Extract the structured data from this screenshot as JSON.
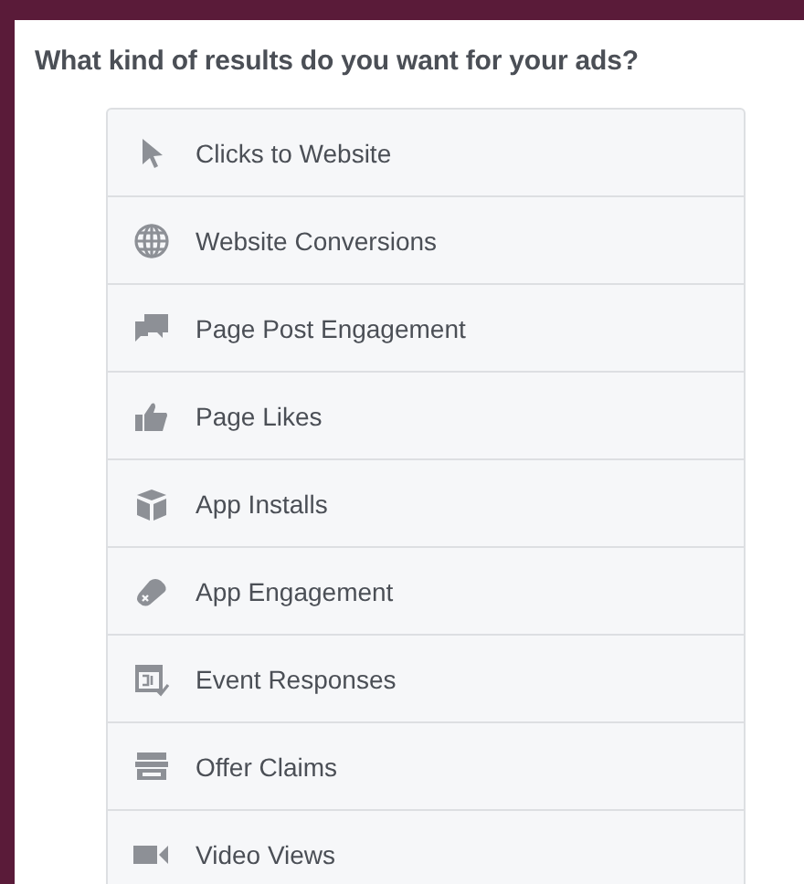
{
  "heading": "What kind of results do you want for your ads?",
  "options": [
    {
      "label": "Clicks to Website"
    },
    {
      "label": "Website Conversions"
    },
    {
      "label": "Page Post Engagement"
    },
    {
      "label": "Page Likes"
    },
    {
      "label": "App Installs"
    },
    {
      "label": "App Engagement"
    },
    {
      "label": "Event Responses"
    },
    {
      "label": "Offer Claims"
    },
    {
      "label": "Video Views"
    }
  ]
}
